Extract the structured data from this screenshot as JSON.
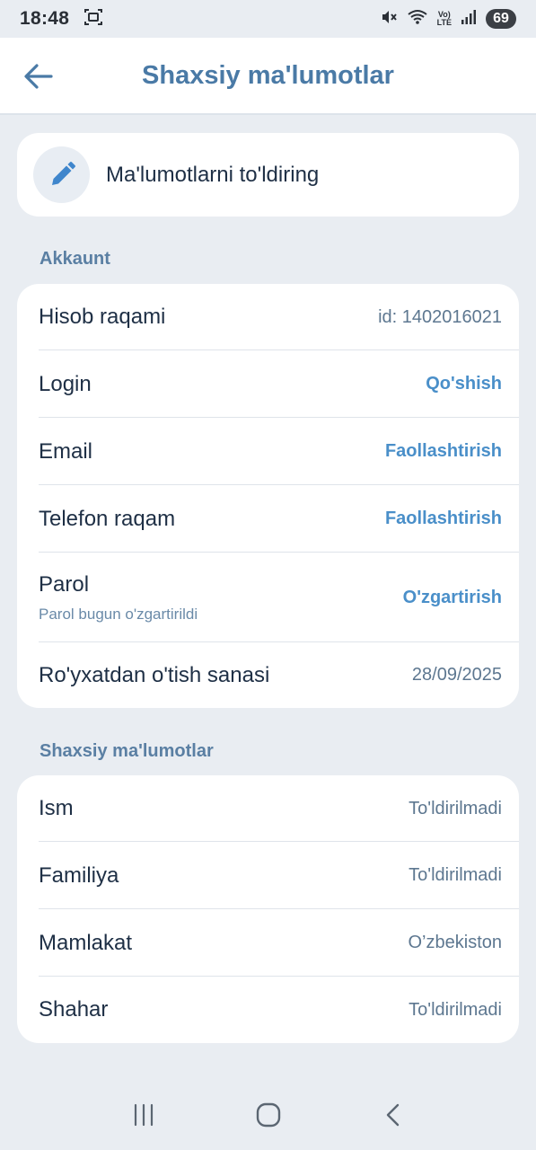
{
  "status_bar": {
    "time": "18:48",
    "battery": "69",
    "volte_top": "Vo)",
    "volte_bottom": "LTE"
  },
  "header": {
    "title": "Shaxsiy ma'lumotlar"
  },
  "edit_card": {
    "label": "Ma'lumotlarni to'ldiring"
  },
  "account": {
    "section_title": "Akkaunt",
    "account_number": {
      "label": "Hisob raqami",
      "value": "id: 1402016021"
    },
    "login": {
      "label": "Login",
      "action": "Qo'shish"
    },
    "email": {
      "label": "Email",
      "action": "Faollashtirish"
    },
    "phone": {
      "label": "Telefon raqam",
      "action": "Faollashtirish"
    },
    "password": {
      "label": "Parol",
      "sub": "Parol bugun o'zgartirildi",
      "action": "O'zgartirish"
    },
    "registered": {
      "label": "Ro'yxatdan o'tish sanasi",
      "value": "28/09/2025"
    }
  },
  "personal": {
    "section_title": "Shaxsiy ma'lumotlar",
    "first_name": {
      "label": "Ism",
      "value": "To'ldirilmadi"
    },
    "last_name": {
      "label": "Familiya",
      "value": "To'ldirilmadi"
    },
    "country": {
      "label": "Mamlakat",
      "value": "O’zbekiston"
    },
    "city": {
      "label": "Shahar",
      "value": "To'ldirilmadi"
    }
  },
  "colors": {
    "accent": "#4a8fc9",
    "title": "#4a7aa6",
    "background": "#e9edf2"
  }
}
